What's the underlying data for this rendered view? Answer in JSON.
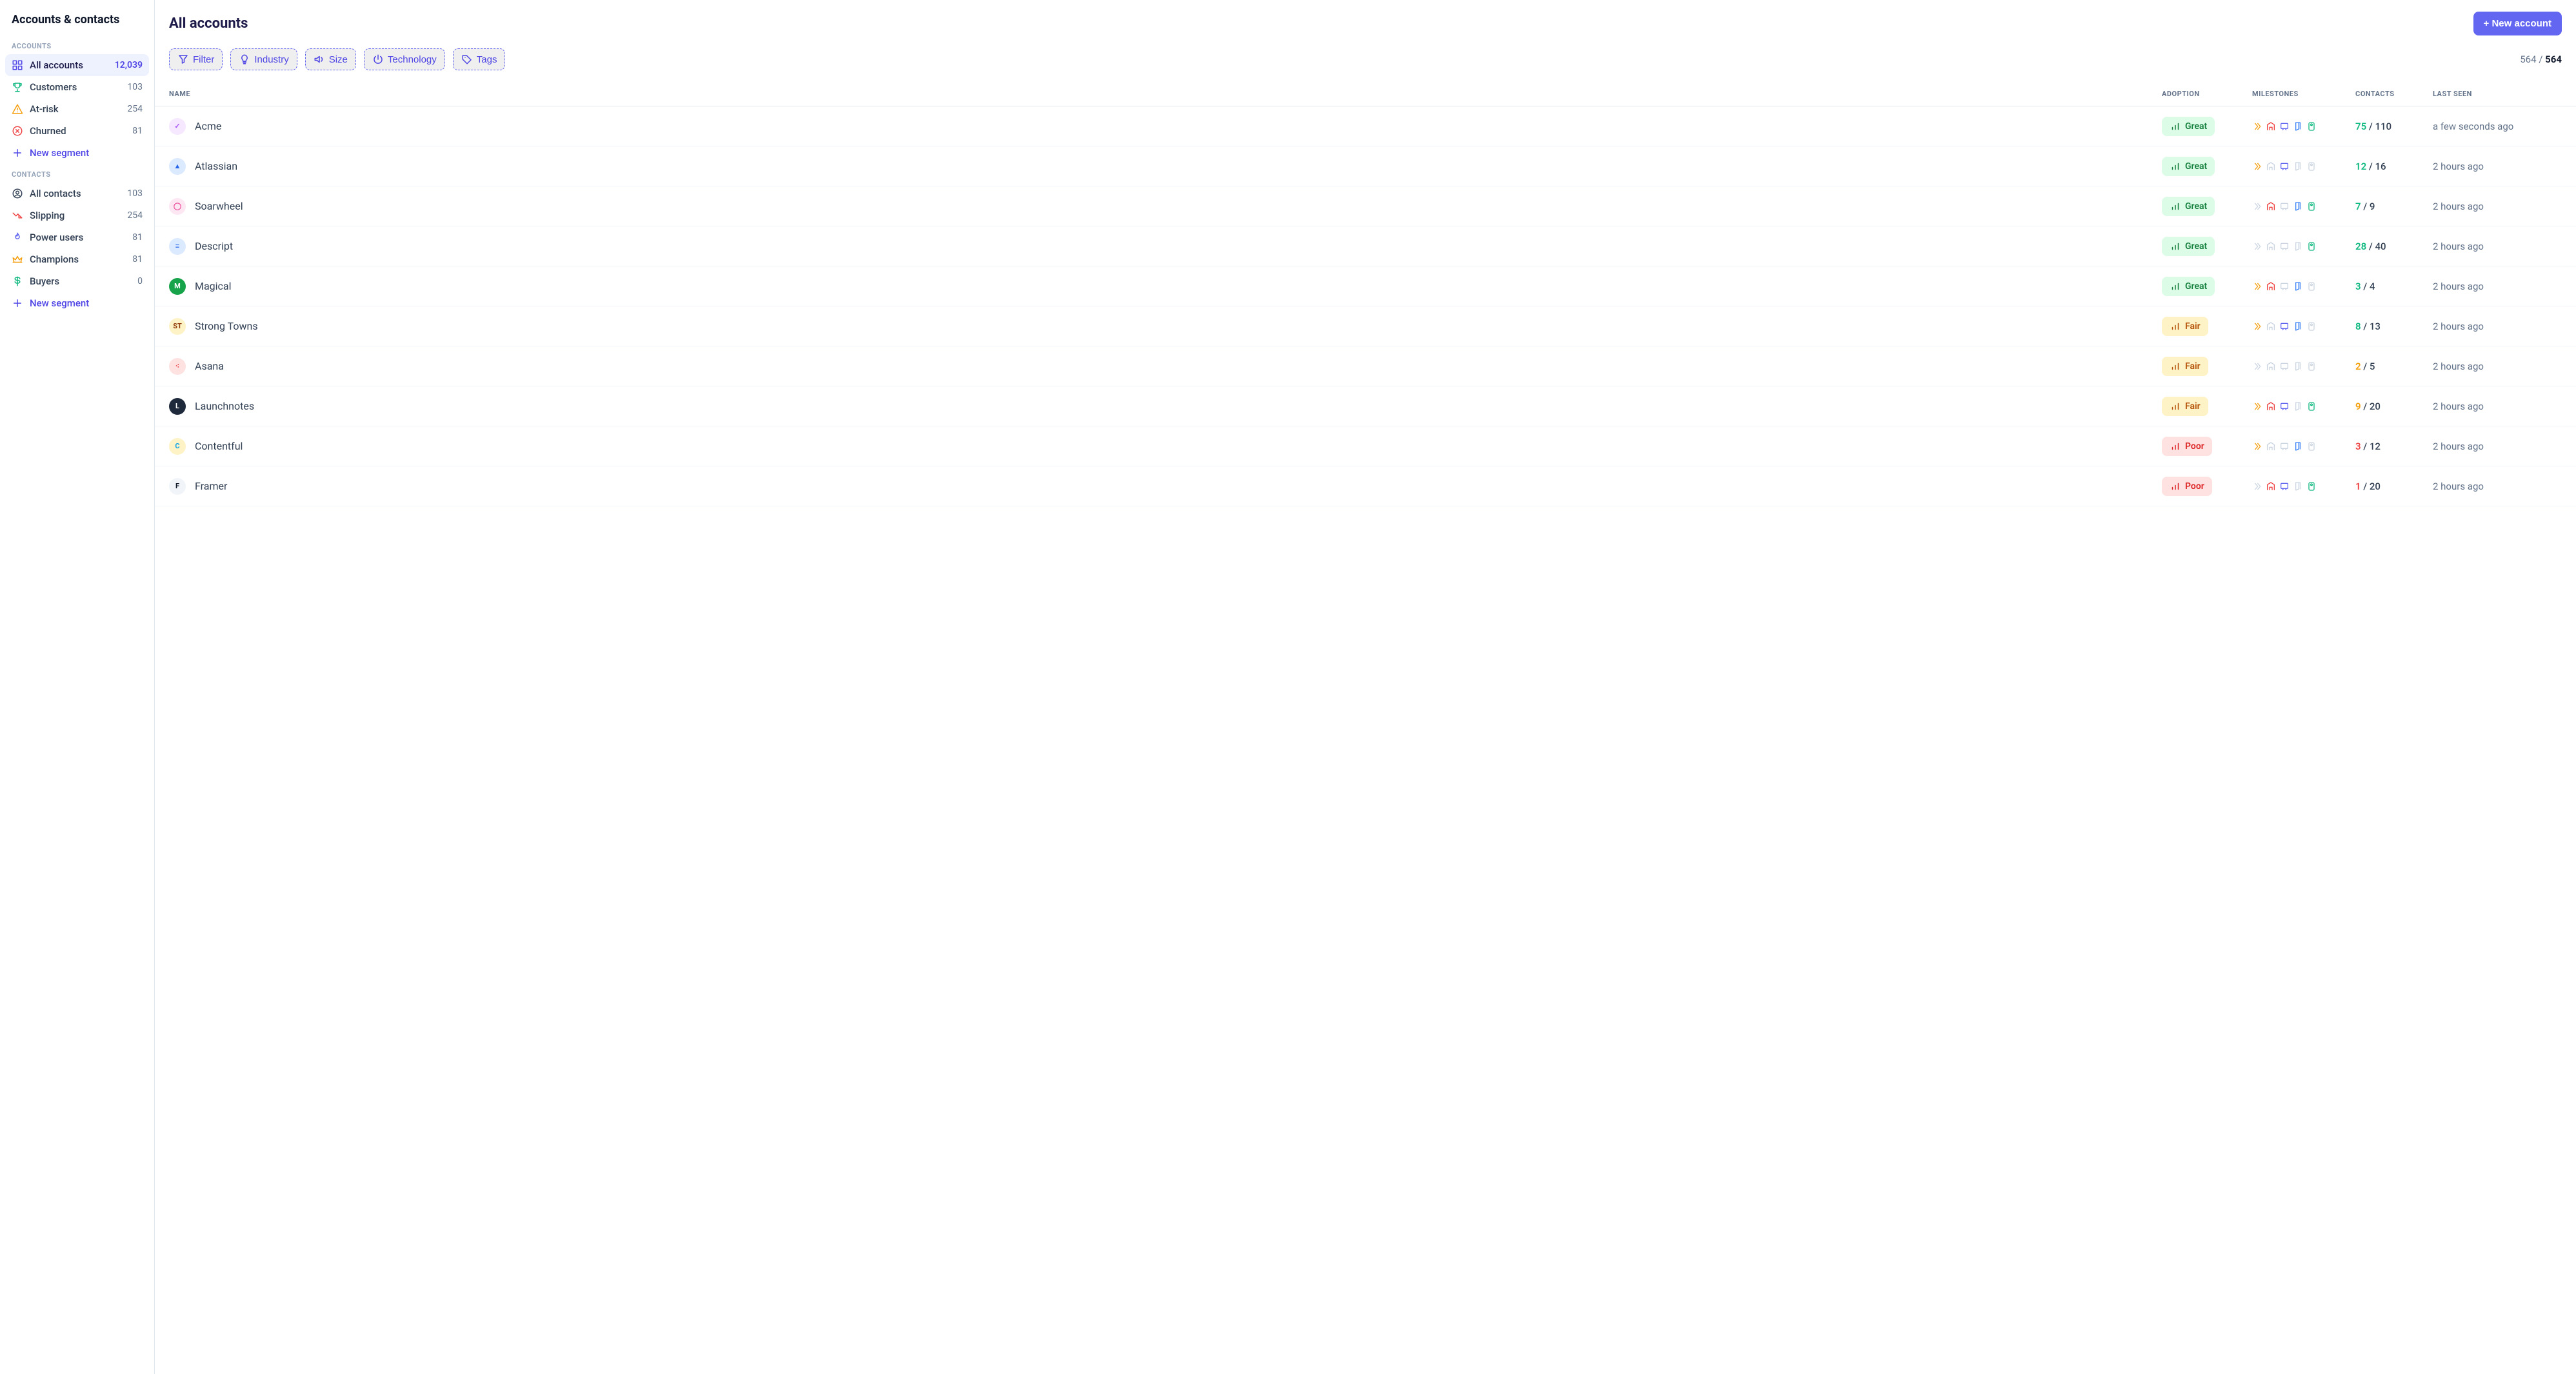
{
  "sidebar": {
    "title": "Accounts & contacts",
    "accounts_label": "ACCOUNTS",
    "contacts_label": "CONTACTS",
    "new_segment_label": "New segment",
    "accounts_items": [
      {
        "id": "all-accounts",
        "label": "All accounts",
        "count": "12,039",
        "icon": "grid",
        "color": "#4f46e5",
        "active": true
      },
      {
        "id": "customers",
        "label": "Customers",
        "count": "103",
        "icon": "trophy",
        "color": "#10b981"
      },
      {
        "id": "at-risk",
        "label": "At-risk",
        "count": "254",
        "icon": "warning",
        "color": "#f59e0b"
      },
      {
        "id": "churned",
        "label": "Churned",
        "count": "81",
        "icon": "x-circle",
        "color": "#ef4444"
      }
    ],
    "contacts_items": [
      {
        "id": "all-contacts",
        "label": "All contacts",
        "count": "103",
        "icon": "user-circle",
        "color": "#334155"
      },
      {
        "id": "slipping",
        "label": "Slipping",
        "count": "254",
        "icon": "trend-down",
        "color": "#ef4444"
      },
      {
        "id": "power-users",
        "label": "Power users",
        "count": "81",
        "icon": "flame",
        "color": "#6366f1"
      },
      {
        "id": "champions",
        "label": "Champions",
        "count": "81",
        "icon": "crown",
        "color": "#f59e0b"
      },
      {
        "id": "buyers",
        "label": "Buyers",
        "count": "0",
        "icon": "dollar",
        "color": "#10b981"
      }
    ]
  },
  "header": {
    "title": "All accounts",
    "new_account_label": "+ New account"
  },
  "filters": [
    {
      "id": "filter",
      "label": "Filter",
      "icon": "funnel"
    },
    {
      "id": "industry",
      "label": "Industry",
      "icon": "bulb"
    },
    {
      "id": "size",
      "label": "Size",
      "icon": "speaker"
    },
    {
      "id": "technology",
      "label": "Technology",
      "icon": "power"
    },
    {
      "id": "tags",
      "label": "Tags",
      "icon": "tag"
    }
  ],
  "pagination": {
    "shown": "564",
    "total": "564",
    "sep": " / "
  },
  "columns": {
    "name": "NAME",
    "adoption": "ADOPTION",
    "milestones": "MILESTONES",
    "contacts": "CONTACTS",
    "last_seen": "LAST SEEN"
  },
  "rows": [
    {
      "name": "Acme",
      "logo": {
        "text": "✓",
        "bg": "#f5e8ff",
        "fg": "#a855f7"
      },
      "adoption": {
        "level": "great",
        "label": "Great"
      },
      "milestones": [
        "on",
        "on",
        "on",
        "on",
        "on"
      ],
      "contacts": {
        "active": "75",
        "total": "110",
        "color": "#10b981"
      },
      "last_seen": "a few seconds ago"
    },
    {
      "name": "Atlassian",
      "logo": {
        "text": "▲",
        "bg": "#dbeafe",
        "fg": "#2563eb"
      },
      "adoption": {
        "level": "great",
        "label": "Great"
      },
      "milestones": [
        "on",
        "off",
        "on",
        "off",
        "off"
      ],
      "contacts": {
        "active": "12",
        "total": "16",
        "color": "#10b981"
      },
      "last_seen": "2 hours ago"
    },
    {
      "name": "Soarwheel",
      "logo": {
        "text": "◯",
        "bg": "#fce7f3",
        "fg": "#ec4899"
      },
      "adoption": {
        "level": "great",
        "label": "Great"
      },
      "milestones": [
        "off",
        "on",
        "off",
        "on",
        "on"
      ],
      "contacts": {
        "active": "7",
        "total": "9",
        "color": "#10b981"
      },
      "last_seen": "2 hours ago"
    },
    {
      "name": "Descript",
      "logo": {
        "text": "≡",
        "bg": "#dbeafe",
        "fg": "#2563eb"
      },
      "adoption": {
        "level": "great",
        "label": "Great"
      },
      "milestones": [
        "off",
        "off",
        "off",
        "off",
        "on"
      ],
      "contacts": {
        "active": "28",
        "total": "40",
        "color": "#10b981"
      },
      "last_seen": "2 hours ago"
    },
    {
      "name": "Magical",
      "logo": {
        "text": "M",
        "bg": "#16a34a",
        "fg": "#ffffff"
      },
      "adoption": {
        "level": "great",
        "label": "Great"
      },
      "milestones": [
        "on",
        "on",
        "off",
        "on",
        "off"
      ],
      "contacts": {
        "active": "3",
        "total": "4",
        "color": "#10b981"
      },
      "last_seen": "2 hours ago"
    },
    {
      "name": "Strong Towns",
      "logo": {
        "text": "ST",
        "bg": "#fef3c7",
        "fg": "#92400e"
      },
      "adoption": {
        "level": "fair",
        "label": "Fair"
      },
      "milestones": [
        "on",
        "off",
        "on",
        "on",
        "off"
      ],
      "contacts": {
        "active": "8",
        "total": "13",
        "color": "#10b981"
      },
      "last_seen": "2 hours ago"
    },
    {
      "name": "Asana",
      "logo": {
        "text": "⁖",
        "bg": "#fee2e2",
        "fg": "#ef4444"
      },
      "adoption": {
        "level": "fair",
        "label": "Fair"
      },
      "milestones": [
        "off",
        "off",
        "off",
        "off",
        "off"
      ],
      "contacts": {
        "active": "2",
        "total": "5",
        "color": "#f59e0b"
      },
      "last_seen": "2 hours ago"
    },
    {
      "name": "Launchnotes",
      "logo": {
        "text": "L",
        "bg": "#1e293b",
        "fg": "#ffffff"
      },
      "adoption": {
        "level": "fair",
        "label": "Fair"
      },
      "milestones": [
        "on",
        "on",
        "on",
        "off",
        "on"
      ],
      "contacts": {
        "active": "9",
        "total": "20",
        "color": "#f59e0b"
      },
      "last_seen": "2 hours ago"
    },
    {
      "name": "Contentful",
      "logo": {
        "text": "C",
        "bg": "#fef3c7",
        "fg": "#0ea5e9"
      },
      "adoption": {
        "level": "poor",
        "label": "Poor"
      },
      "milestones": [
        "on",
        "off",
        "off",
        "on",
        "off"
      ],
      "contacts": {
        "active": "3",
        "total": "12",
        "color": "#ef4444"
      },
      "last_seen": "2 hours ago"
    },
    {
      "name": "Framer",
      "logo": {
        "text": "F",
        "bg": "#f1f5f9",
        "fg": "#0f172a"
      },
      "adoption": {
        "level": "poor",
        "label": "Poor"
      },
      "milestones": [
        "off",
        "on",
        "on",
        "off",
        "on"
      ],
      "contacts": {
        "active": "1",
        "total": "20",
        "color": "#ef4444"
      },
      "last_seen": "2 hours ago"
    }
  ],
  "milestone_colors": [
    "#f59e0b",
    "#ef4444",
    "#6366f1",
    "#3b82f6",
    "#10b981"
  ]
}
